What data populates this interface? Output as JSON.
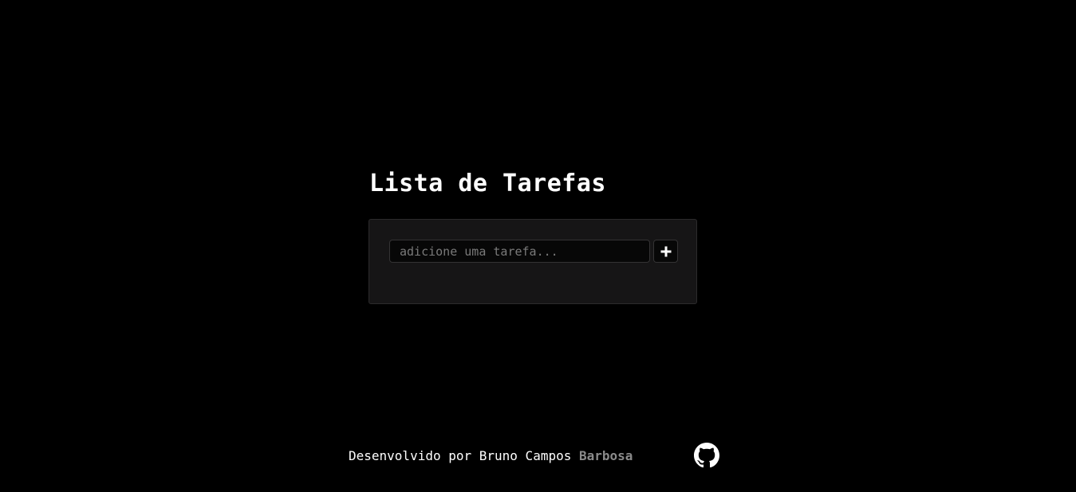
{
  "header": {
    "title": "Lista de Tarefas"
  },
  "task_form": {
    "input_value": "",
    "input_placeholder": "adicione uma tarefa...",
    "add_button_icon": "plus-icon"
  },
  "footer": {
    "credit_prefix": "Desenvolvido por Bruno Campos ",
    "credit_highlight": "Barbosa",
    "github_icon": "github-icon"
  },
  "colors": {
    "background": "#000000",
    "card_background": "#161516",
    "text": "#ffffff",
    "highlight_text": "#8a8a8a"
  }
}
